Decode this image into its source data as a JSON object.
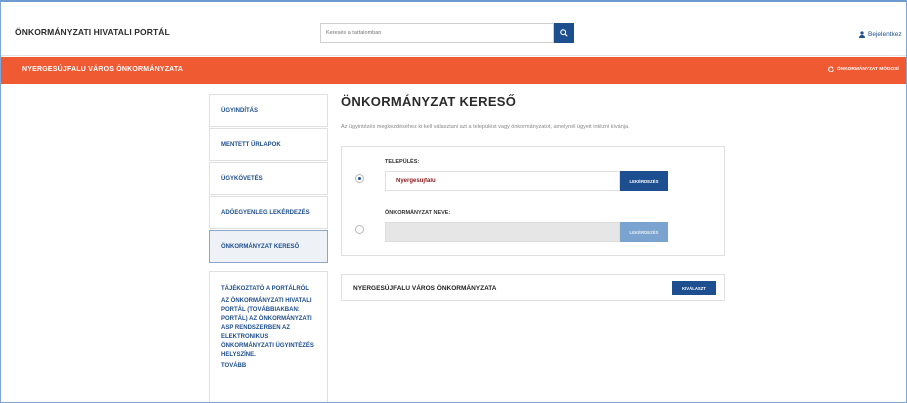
{
  "header": {
    "brand": "ÖNKORMÁNYZATI HIVATALI PORTÁL",
    "search_placeholder": "Keresés a tartalomban",
    "login_label": "Bejelentkez"
  },
  "municipality_bar": {
    "name": "NYERGESÚJFALU VÁROS ÖNKORMÁNYZATA",
    "change_label": "ÖNKORMÁNYZAT MÓDOSÍ"
  },
  "sidebar": {
    "items": [
      {
        "label": "ÜGYINDÍTÁS"
      },
      {
        "label": "MENTETT ŰRLAPOK"
      },
      {
        "label": "ÜGYKÖVETÉS"
      },
      {
        "label": "ADÓEGYENLEG LEKÉRDEZÉS"
      },
      {
        "label": "ÖNKORMÁNYZAT KERESŐ"
      }
    ],
    "info": {
      "title": "TÁJÉKOZTATÓ A PORTÁLRÓL",
      "text": "AZ ÖNKORMÁNYZATI HIVATALI PORTÁL (TOVÁBBIAKBAN: PORTÁL) AZ ÖNKORMÁNYZATI ASP RENDSZERBEN AZ ELEKTRONIKUS ÖNKORMÁNYZATI ÜGYINTÉZÉS HELYSZÍNE.",
      "more": "TOVÁBB"
    }
  },
  "main": {
    "title": "ÖNKORMÁNYZAT KERESŐ",
    "intro": "Az ügyintézés megkezdéséhez ki kell választani azt a települést vagy önkormányzatot, amelynél ügyeit intézni kívánja.",
    "settlement_label": "TELEPÜLÉS:",
    "settlement_value": "Nyergesújfalu",
    "query_label": "LEKÉRDEZÉS",
    "muni_name_label": "ÖNKORMÁNYZAT NEVE:",
    "muni_name_value": "",
    "query_label_2": "LEKÉRDEZÉS",
    "result_name": "NYERGESÚJFALU VÁROS ÖNKORMÁNYZATA",
    "select_label": "KIVÁLASZT"
  },
  "colors": {
    "primary": "#1d4e8f",
    "accent": "#ef5a33"
  }
}
